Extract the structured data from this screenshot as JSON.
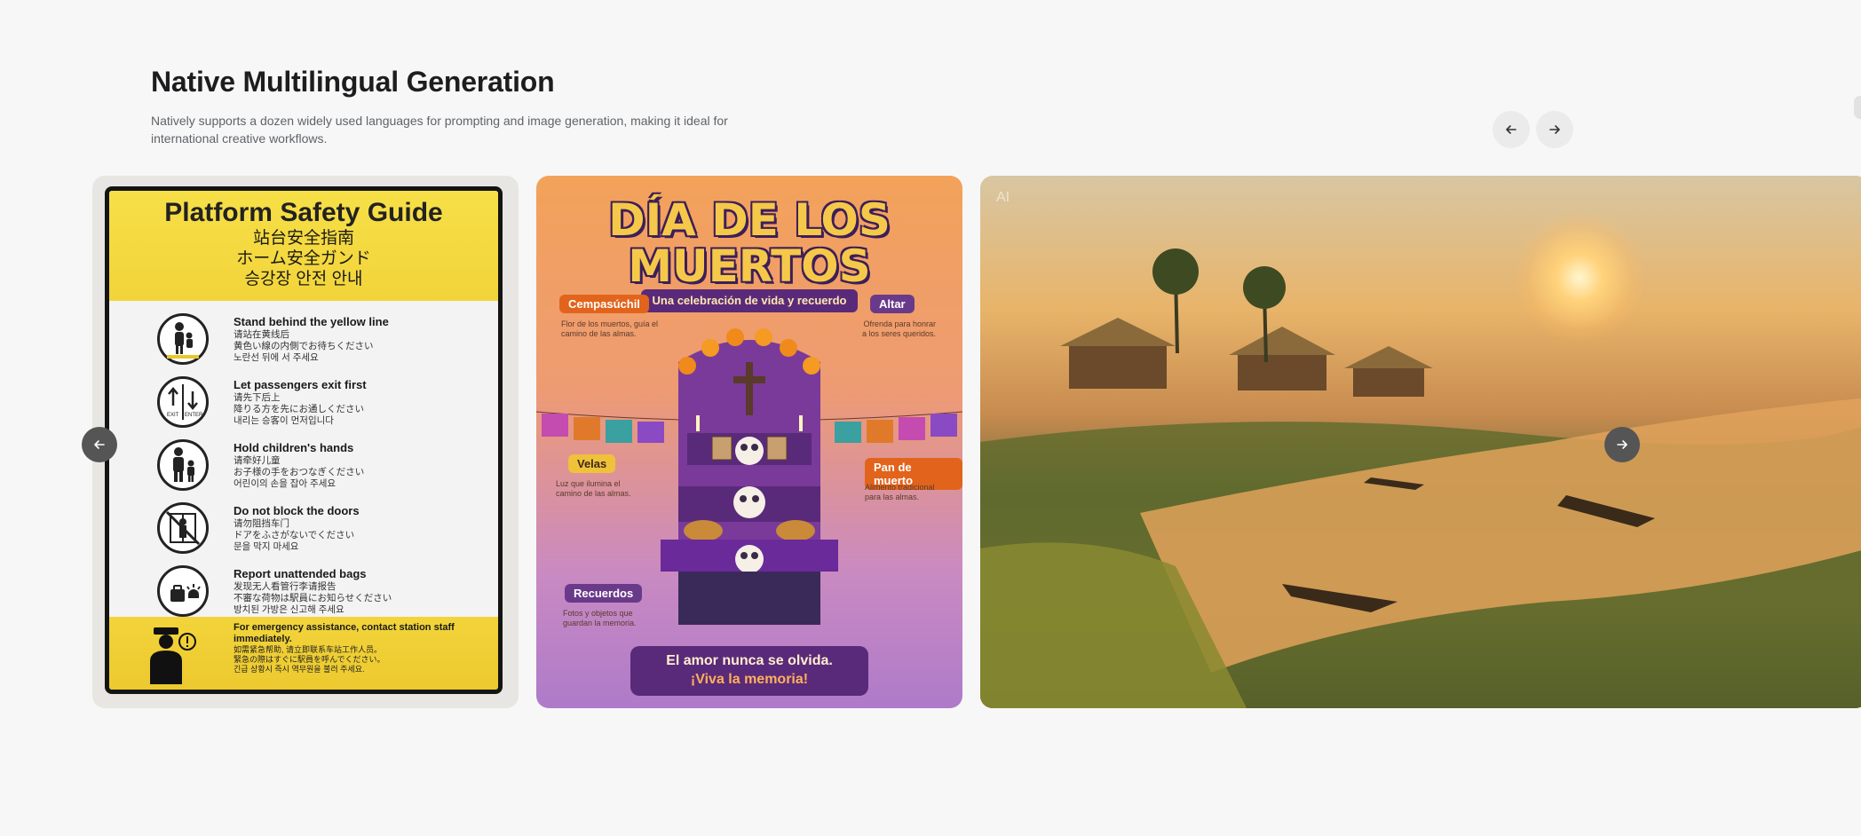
{
  "header": {
    "title": "Native Multilingual Generation",
    "subtitle": "Natively supports a dozen widely used languages for prompting and image generation, making it ideal for international creative workflows."
  },
  "colors": {
    "background": "#f7f7f7",
    "nav_button": "#ebebeb",
    "carousel_button": "#555555"
  },
  "icons": {
    "prev": "arrow-left-icon",
    "next": "arrow-right-icon"
  },
  "card1": {
    "title": "Platform Safety Guide",
    "title_zh": "站台安全指南",
    "title_ja": "ホーム安全ガンド",
    "title_ko": "승강장 안전 안내",
    "items": [
      {
        "en": "Stand behind the yellow line",
        "zh": "请站在黄线后",
        "ja": "黄色い線の内側でお待ちください",
        "ko": "노란선 뒤에 서 주세요"
      },
      {
        "en": "Let passengers exit first",
        "zh": "请先下后上",
        "ja": "降りる方を先にお通しください",
        "ko": "내리는 승客이 먼저입니다"
      },
      {
        "en": "Hold children's hands",
        "zh": "请牵好儿童",
        "ja": "お子様の手をおつなぎください",
        "ko": "어린이의 손을 잡아 주세요"
      },
      {
        "en": "Do not block the doors",
        "zh": "请勿阻挡车门",
        "ja": "ドアをふさがないでください",
        "ko": "문을 막지 마세요"
      },
      {
        "en": "Report unattended bags",
        "zh": "发现无人看管行李请报告",
        "ja": "不審な荷物は駅員にお知らせください",
        "ko": "방치된 가방은 신고해 주세요"
      }
    ],
    "exit_label": "EXIT",
    "enter_label": "ENTER",
    "footer_en": "For emergency assistance, contact station staff immediately.",
    "footer_zh": "如需紧急帮助, 请立即联系车站工作人员。",
    "footer_ja": "緊急の際はすぐに駅員を呼んでください。",
    "footer_ko": "긴급 상황시 즉시 역무원을 불러 주세요."
  },
  "card2": {
    "title_line1": "DÍA DE LOS",
    "title_line2": "MUERTOS",
    "ribbon": "Una celebración de vida y recuerdo",
    "labels": [
      {
        "label": "Cempasúchil",
        "desc": "Flor de los muertos, guía el camino de las almas."
      },
      {
        "label": "Altar",
        "desc": "Ofrenda para honrar a los seres queridos."
      },
      {
        "label": "Velas",
        "desc": "Luz que ilumina el camino de las almas."
      },
      {
        "label": "Pan de muerto",
        "desc": "Alimento tradicional para las almas."
      },
      {
        "label": "Recuerdos",
        "desc": "Fotos y objetos que guardan la memoria."
      }
    ],
    "banner_line1": "El amor nunca se olvida.",
    "banner_line2": "¡Viva la memoria!"
  },
  "card3": {
    "badge": "AI"
  }
}
